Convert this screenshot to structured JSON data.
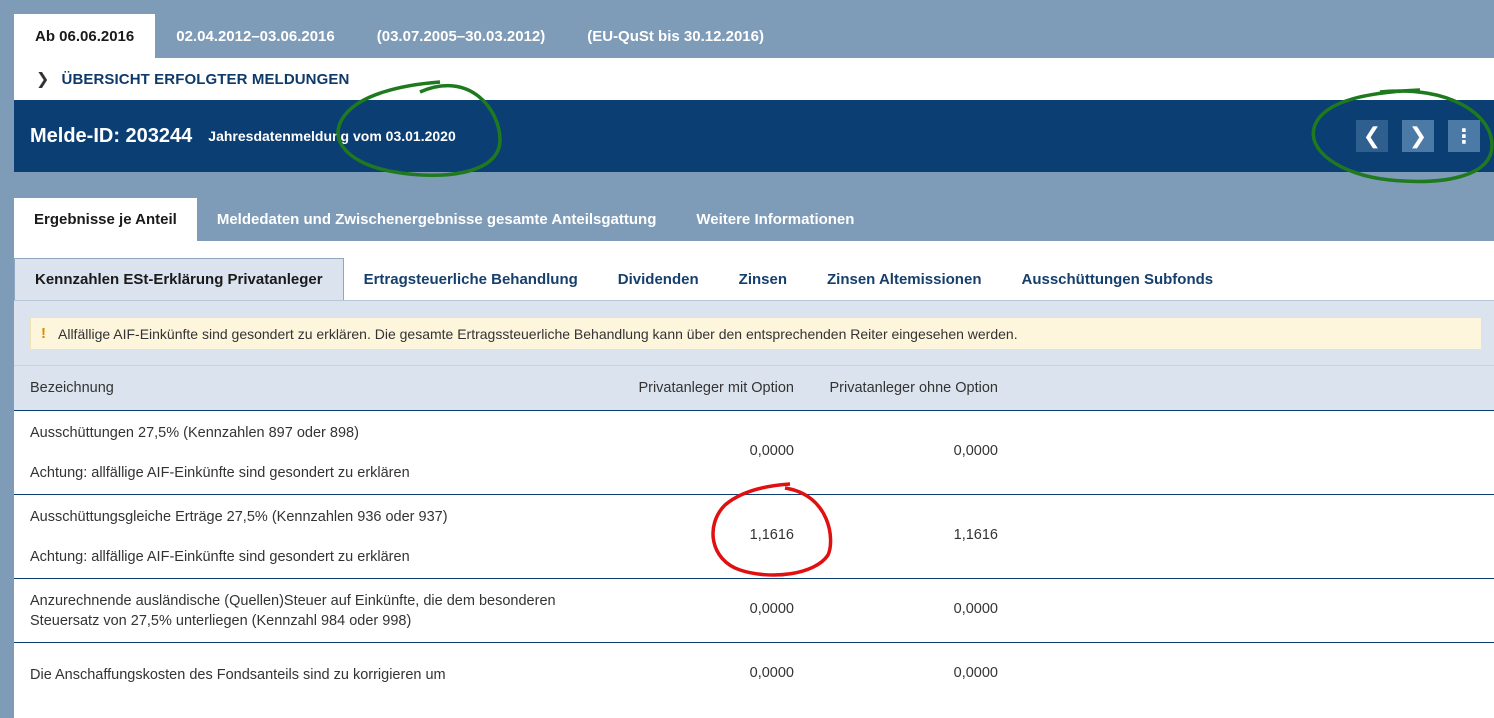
{
  "period_tabs": [
    "Ab 06.06.2016",
    "02.04.2012–03.06.2016",
    "(03.07.2005–30.03.2012)",
    "(EU-QuSt bis 30.12.2016)"
  ],
  "overview_link": "ÜBERSICHT ERFOLGTER MELDUNGEN",
  "header": {
    "melde_id": "Melde-ID: 203244",
    "subtitle": "Jahresdatenmeldung vom 03.01.2020"
  },
  "section_tabs": [
    "Ergebnisse je Anteil",
    "Meldedaten und Zwischenergebnisse gesamte Anteilsgattung",
    "Weitere Informationen"
  ],
  "sub_tabs": [
    "Kennzahlen ESt-Erklärung Privatanleger",
    "Ertragsteuerliche Behandlung",
    "Dividenden",
    "Zinsen",
    "Zinsen Altemissionen",
    "Ausschüttungen Subfonds"
  ],
  "notice": "Allfällige AIF-Einkünfte sind gesondert zu erklären. Die gesamte Ertragssteuerliche Behandlung kann über den entsprechenden Reiter eingesehen werden.",
  "table": {
    "headers": {
      "name": "Bezeichnung",
      "mit": "Privatanleger mit Option",
      "ohne": "Privatanleger ohne Option"
    },
    "rows": [
      {
        "line1": "Ausschüttungen 27,5% (Kennzahlen 897 oder 898)",
        "line2": "Achtung: allfällige AIF-Einkünfte sind gesondert zu erklären",
        "mit": "0,0000",
        "ohne": "0,0000"
      },
      {
        "line1": "Ausschüttungsgleiche Erträge 27,5% (Kennzahlen 936 oder 937)",
        "line2": "Achtung: allfällige AIF-Einkünfte sind gesondert zu erklären",
        "mit": "1,1616",
        "ohne": "1,1616"
      },
      {
        "line1": "Anzurechnende ausländische (Quellen)Steuer auf Einkünfte, die dem besonderen",
        "line2": "Steuersatz von 27,5% unterliegen (Kennzahl 984 oder 998)",
        "mit": "0,0000",
        "ohne": "0,0000"
      },
      {
        "line1": "Die Anschaffungskosten des Fondsanteils sind zu korrigieren um",
        "line2": "",
        "mit": "0,0000",
        "ohne": "0,0000"
      }
    ]
  }
}
